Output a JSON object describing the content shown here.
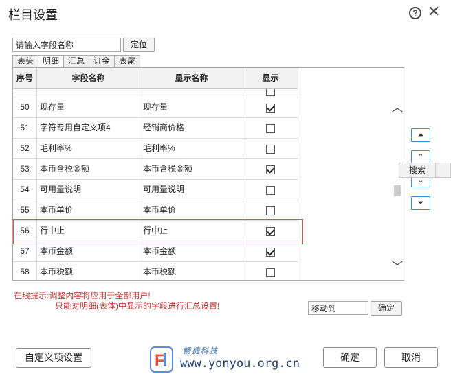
{
  "dialog": {
    "title": "栏目设置",
    "help_icon": "help-circle-icon",
    "close_icon": "close-icon"
  },
  "search": {
    "value": "请输入字段名称",
    "locate_label": "定位"
  },
  "tabs": [
    {
      "label": "表头",
      "active": false
    },
    {
      "label": "明细",
      "active": true
    },
    {
      "label": "汇总",
      "active": false
    },
    {
      "label": "订金",
      "active": false
    },
    {
      "label": "表尾",
      "active": false
    }
  ],
  "grid": {
    "columns": [
      "序号",
      "字段名称",
      "显示名称",
      "显示"
    ],
    "rows": [
      {
        "num": "50",
        "field": "现存量",
        "display": "现存量",
        "show": true
      },
      {
        "num": "51",
        "field": "字符专用自定义项4",
        "display": "经销商价格",
        "show": false
      },
      {
        "num": "52",
        "field": "毛利率%",
        "display": "毛利率%",
        "show": false
      },
      {
        "num": "53",
        "field": "本币含税金额",
        "display": "本币含税金额",
        "show": true
      },
      {
        "num": "54",
        "field": "可用量说明",
        "display": "可用量说明",
        "show": false
      },
      {
        "num": "55",
        "field": "本币单价",
        "display": "本币单价",
        "show": false
      },
      {
        "num": "56",
        "field": "行中止",
        "display": "行中止",
        "show": true,
        "highlighted": true
      },
      {
        "num": "57",
        "field": "本币金额",
        "display": "本币金额",
        "show": true
      },
      {
        "num": "58",
        "field": "本币税额",
        "display": "本币税额",
        "show": false
      }
    ]
  },
  "side_buttons": {
    "search_label": "搜索",
    "top_icon": "move-top-icon",
    "up_icon": "move-up-icon",
    "down_icon": "move-down-icon",
    "bottom_icon": "move-bottom-icon"
  },
  "hint": {
    "prefix": "在线提示:",
    "line1": "调整内容将应用于全部用户!",
    "line2": "只能对明细(表体)中显示的字段进行汇总设置!"
  },
  "move_to": {
    "value": "移动到",
    "ok_label": "确定"
  },
  "footer": {
    "custom_label": "自定义项设置",
    "ok_label": "确定",
    "cancel_label": "取消"
  },
  "watermark": {
    "brand": "畅捷科技",
    "url": "www.yonyou.org.cn"
  },
  "colors": {
    "highlight_border": "#d9534f",
    "hint_text": "#cc3333",
    "accent_blue": "#3b8fd0"
  }
}
